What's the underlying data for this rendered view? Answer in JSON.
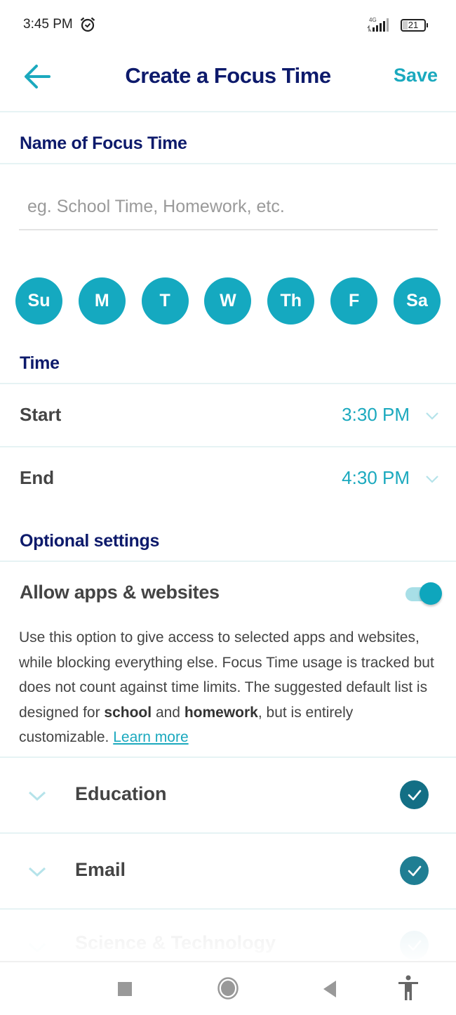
{
  "status_bar": {
    "time": "3:45 PM",
    "alarm_icon": "alarm-clock-icon",
    "network": "4G",
    "battery": "21"
  },
  "app_bar": {
    "back_icon": "arrow-left-icon",
    "title": "Create a Focus Time",
    "save_label": "Save"
  },
  "name_section": {
    "title": "Name of Focus Time",
    "input_value": "",
    "input_placeholder": "eg. School Time, Homework, etc."
  },
  "days": [
    {
      "label": "Su",
      "selected": true
    },
    {
      "label": "M",
      "selected": true
    },
    {
      "label": "T",
      "selected": true
    },
    {
      "label": "W",
      "selected": true
    },
    {
      "label": "Th",
      "selected": true
    },
    {
      "label": "F",
      "selected": true
    },
    {
      "label": "Sa",
      "selected": true
    }
  ],
  "time_section": {
    "title": "Time",
    "start_label": "Start",
    "start_value": "3:30 PM",
    "end_label": "End",
    "end_value": "4:30 PM"
  },
  "optional_section": {
    "title": "Optional settings",
    "toggle_label": "Allow apps & websites",
    "toggle_on": true,
    "description_part1": "Use this option to give access to selected apps and websites, while blocking everything else. Focus Time usage is tracked but does not count against time limits. The suggested default list is designed for ",
    "description_bold1": "school",
    "description_part2": " and ",
    "description_bold2": "homework",
    "description_part3": ", but is entirely customizable. ",
    "learn_more": "Learn more"
  },
  "categories": [
    {
      "label": "Education",
      "checked": true
    },
    {
      "label": "Email",
      "checked": true
    },
    {
      "label": "Science & Technology",
      "checked": true
    }
  ],
  "nav_bar": {
    "recents_icon": "square-icon",
    "home_icon": "circle-home-icon",
    "back_icon": "triangle-back-icon",
    "accessibility_icon": "accessibility-icon"
  },
  "colors": {
    "accent": "#1ba9be",
    "day_fill": "#15a9c0",
    "heading": "#0d1a6b",
    "check_fill": "#136f85"
  }
}
